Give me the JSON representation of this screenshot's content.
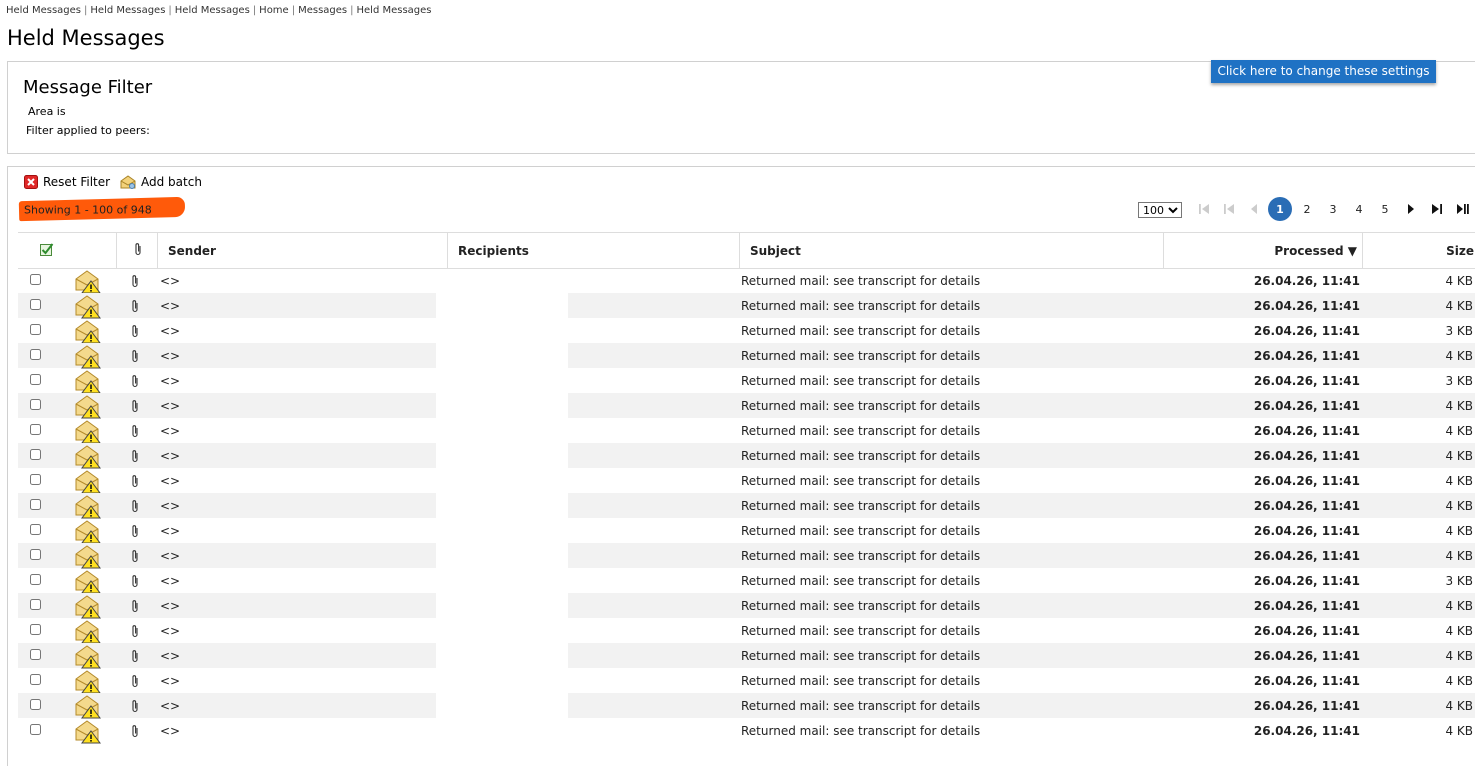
{
  "breadcrumb": [
    "Held Messages",
    "Held Messages",
    "Held Messages",
    "Home",
    "Messages",
    "Held Messages"
  ],
  "page_title": "Held Messages",
  "filter": {
    "title": "Message Filter",
    "area_label": "Area is",
    "peers_label": "Filter applied to peers:",
    "settings_button": "Click here to change these settings"
  },
  "toolbar": {
    "reset_filter": "Reset Filter",
    "add_batch": "Add batch",
    "showing": "Showing 1 - 100 of 948"
  },
  "pager": {
    "page_size": "100",
    "pages": [
      "1",
      "2",
      "3",
      "4",
      "5"
    ],
    "current_page": "1"
  },
  "table": {
    "headers": {
      "sender": "Sender",
      "recipients": "Recipients",
      "subject": "Subject",
      "processed": "Processed ▼",
      "size": "Size"
    },
    "rows": [
      {
        "sender": "<>",
        "subject": "Returned mail: see transcript for details",
        "processed": "26.04.26, 11:41",
        "size": "4 KB"
      },
      {
        "sender": "<>",
        "subject": "Returned mail: see transcript for details",
        "processed": "26.04.26, 11:41",
        "size": "4 KB"
      },
      {
        "sender": "<>",
        "subject": "Returned mail: see transcript for details",
        "processed": "26.04.26, 11:41",
        "size": "3 KB"
      },
      {
        "sender": "<>",
        "subject": "Returned mail: see transcript for details",
        "processed": "26.04.26, 11:41",
        "size": "4 KB"
      },
      {
        "sender": "<>",
        "subject": "Returned mail: see transcript for details",
        "processed": "26.04.26, 11:41",
        "size": "3 KB"
      },
      {
        "sender": "<>",
        "subject": "Returned mail: see transcript for details",
        "processed": "26.04.26, 11:41",
        "size": "4 KB"
      },
      {
        "sender": "<>",
        "subject": "Returned mail: see transcript for details",
        "processed": "26.04.26, 11:41",
        "size": "4 KB"
      },
      {
        "sender": "<>",
        "subject": "Returned mail: see transcript for details",
        "processed": "26.04.26, 11:41",
        "size": "4 KB"
      },
      {
        "sender": "<>",
        "subject": "Returned mail: see transcript for details",
        "processed": "26.04.26, 11:41",
        "size": "4 KB"
      },
      {
        "sender": "<>",
        "subject": "Returned mail: see transcript for details",
        "processed": "26.04.26, 11:41",
        "size": "4 KB"
      },
      {
        "sender": "<>",
        "subject": "Returned mail: see transcript for details",
        "processed": "26.04.26, 11:41",
        "size": "4 KB"
      },
      {
        "sender": "<>",
        "subject": "Returned mail: see transcript for details",
        "processed": "26.04.26, 11:41",
        "size": "4 KB"
      },
      {
        "sender": "<>",
        "subject": "Returned mail: see transcript for details",
        "processed": "26.04.26, 11:41",
        "size": "3 KB"
      },
      {
        "sender": "<>",
        "subject": "Returned mail: see transcript for details",
        "processed": "26.04.26, 11:41",
        "size": "4 KB"
      },
      {
        "sender": "<>",
        "subject": "Returned mail: see transcript for details",
        "processed": "26.04.26, 11:41",
        "size": "4 KB"
      },
      {
        "sender": "<>",
        "subject": "Returned mail: see transcript for details",
        "processed": "26.04.26, 11:41",
        "size": "4 KB"
      },
      {
        "sender": "<>",
        "subject": "Returned mail: see transcript for details",
        "processed": "26.04.26, 11:41",
        "size": "4 KB"
      },
      {
        "sender": "<>",
        "subject": "Returned mail: see transcript for details",
        "processed": "26.04.26, 11:41",
        "size": "4 KB"
      },
      {
        "sender": "<>",
        "subject": "Returned mail: see transcript for details",
        "processed": "26.04.26, 11:41",
        "size": "4 KB"
      }
    ]
  },
  "colors": {
    "accent_button": "#1f72c4",
    "current_page": "#2a6db5",
    "highlight": "#ff5a0a",
    "row_alt": "#f2f2f2"
  },
  "icons": {
    "reset": "red-x-icon",
    "add_batch": "batch-icon",
    "select_all": "check-select-icon",
    "attachment": "paperclip-icon",
    "held": "envelope-warning-icon"
  }
}
